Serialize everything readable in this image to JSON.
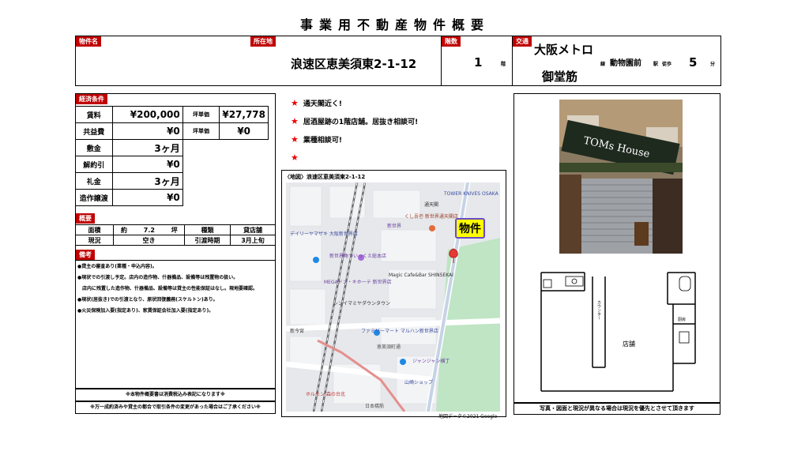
{
  "title": "事業用不動産物件概要",
  "header": {
    "name_label": "物件名",
    "name_value": "",
    "location_label": "所在地",
    "location_value": "浪速区恵美須東2-1-12",
    "floor_label": "階数",
    "floor_value": "1",
    "floor_unit": "階",
    "transport_label": "交通",
    "line_name_1": "大阪メトロ",
    "line_name_2": "御堂筋",
    "line_suffix": "線",
    "station": "動物園前",
    "station_suffix": "駅",
    "walk_label": "徒歩",
    "walk_minutes": "5",
    "walk_unit": "分"
  },
  "economics": {
    "section_label": "経済条件",
    "rows": [
      {
        "label": "賃料",
        "value": "¥200,000",
        "sub_label": "坪単価",
        "sub_value": "¥27,778"
      },
      {
        "label": "共益費",
        "value": "¥0",
        "sub_label": "坪単価",
        "sub_value": "¥0"
      },
      {
        "label": "敷金",
        "value": "3ヶ月"
      },
      {
        "label": "解約引",
        "value": "¥0"
      },
      {
        "label": "礼金",
        "value": "3ヶ月"
      },
      {
        "label": "造作譲渡",
        "value": "¥0"
      }
    ]
  },
  "overview": {
    "section_label": "概要",
    "area_label": "面積",
    "area_prefix": "約",
    "area_value": "7.2",
    "area_unit": "坪",
    "type_label": "種類",
    "type_value": "貸店舗",
    "status_label": "現況",
    "status_value": "空き",
    "handover_label": "引渡時期",
    "handover_value": "3月上旬"
  },
  "remarks": {
    "section_label": "備考",
    "lines": [
      "●貸主の審査あり(業種・申込内容)。",
      "●現状での引渡し予定。店内の造作物、什器備品、設備等は残置物の扱い。",
      "店内に残置した造作物、什器備品、設備等は貸主の性能保証はなし。現地要確認。",
      "●現状(居抜き)での引渡となり、原状回復義務(スケルトン)あり。",
      "●火災保険加入要(指定あり)、家賃保証会社加入要(指定あり)。"
    ],
    "tax_note": "※本物件概要書は消費税込み表記になります※",
    "change_note": "※万一成約済みや貸主の都合で取引条件の変更があった場合はご了承ください※"
  },
  "features": [
    "通天閣近く!",
    "居酒屋跡の1階店舗。居抜き相談可!",
    "業種相談可!",
    ""
  ],
  "map": {
    "caption": "〈地図〉浪速区恵美須東2-1-12",
    "marker_label": "物件",
    "credit": "地図データ©2021 Google",
    "labels": {
      "tower_knives": "TOWER KNIVES OSAKA",
      "tsutenkaku": "通天閣",
      "kushikatsu": "くし吾壱 新世界通天閣店",
      "shinsekai": "新世界",
      "daily": "デイリーヤマザキ 大阪新世界店",
      "yoshimoto": "新世界角ついっくえ総本店",
      "mega": "MEGAドン・キホーテ 新世界店",
      "magic": "Magic Cafe&Bar SHINSEKAI",
      "shiniimai": "シンイマミヤダウンタウン",
      "family": "ファミリーマート マルハン新世界店",
      "shinimamiya": "新今宮",
      "ebisu_ave": "恵美須町通",
      "jyanjyan": "ジャンジャン横丁",
      "yamazaki": "山崎ショップ",
      "horumon": "ホルモン 森の台北",
      "nipponbashi": "日本橋筋",
      "sakai": "堺筋"
    }
  },
  "photo": {
    "sign_text": "TOMs House",
    "plan_shop_label": "店舗",
    "plan_counter_label": "カウンター",
    "plan_kitchen_label": "厨房",
    "footer": "写真・図面と現況が異なる場合は現況を優先とさせて頂きます"
  },
  "colors": {
    "label_red": "#c00000",
    "star_red": "#e00000",
    "marker_yellow": "#ffff00"
  }
}
